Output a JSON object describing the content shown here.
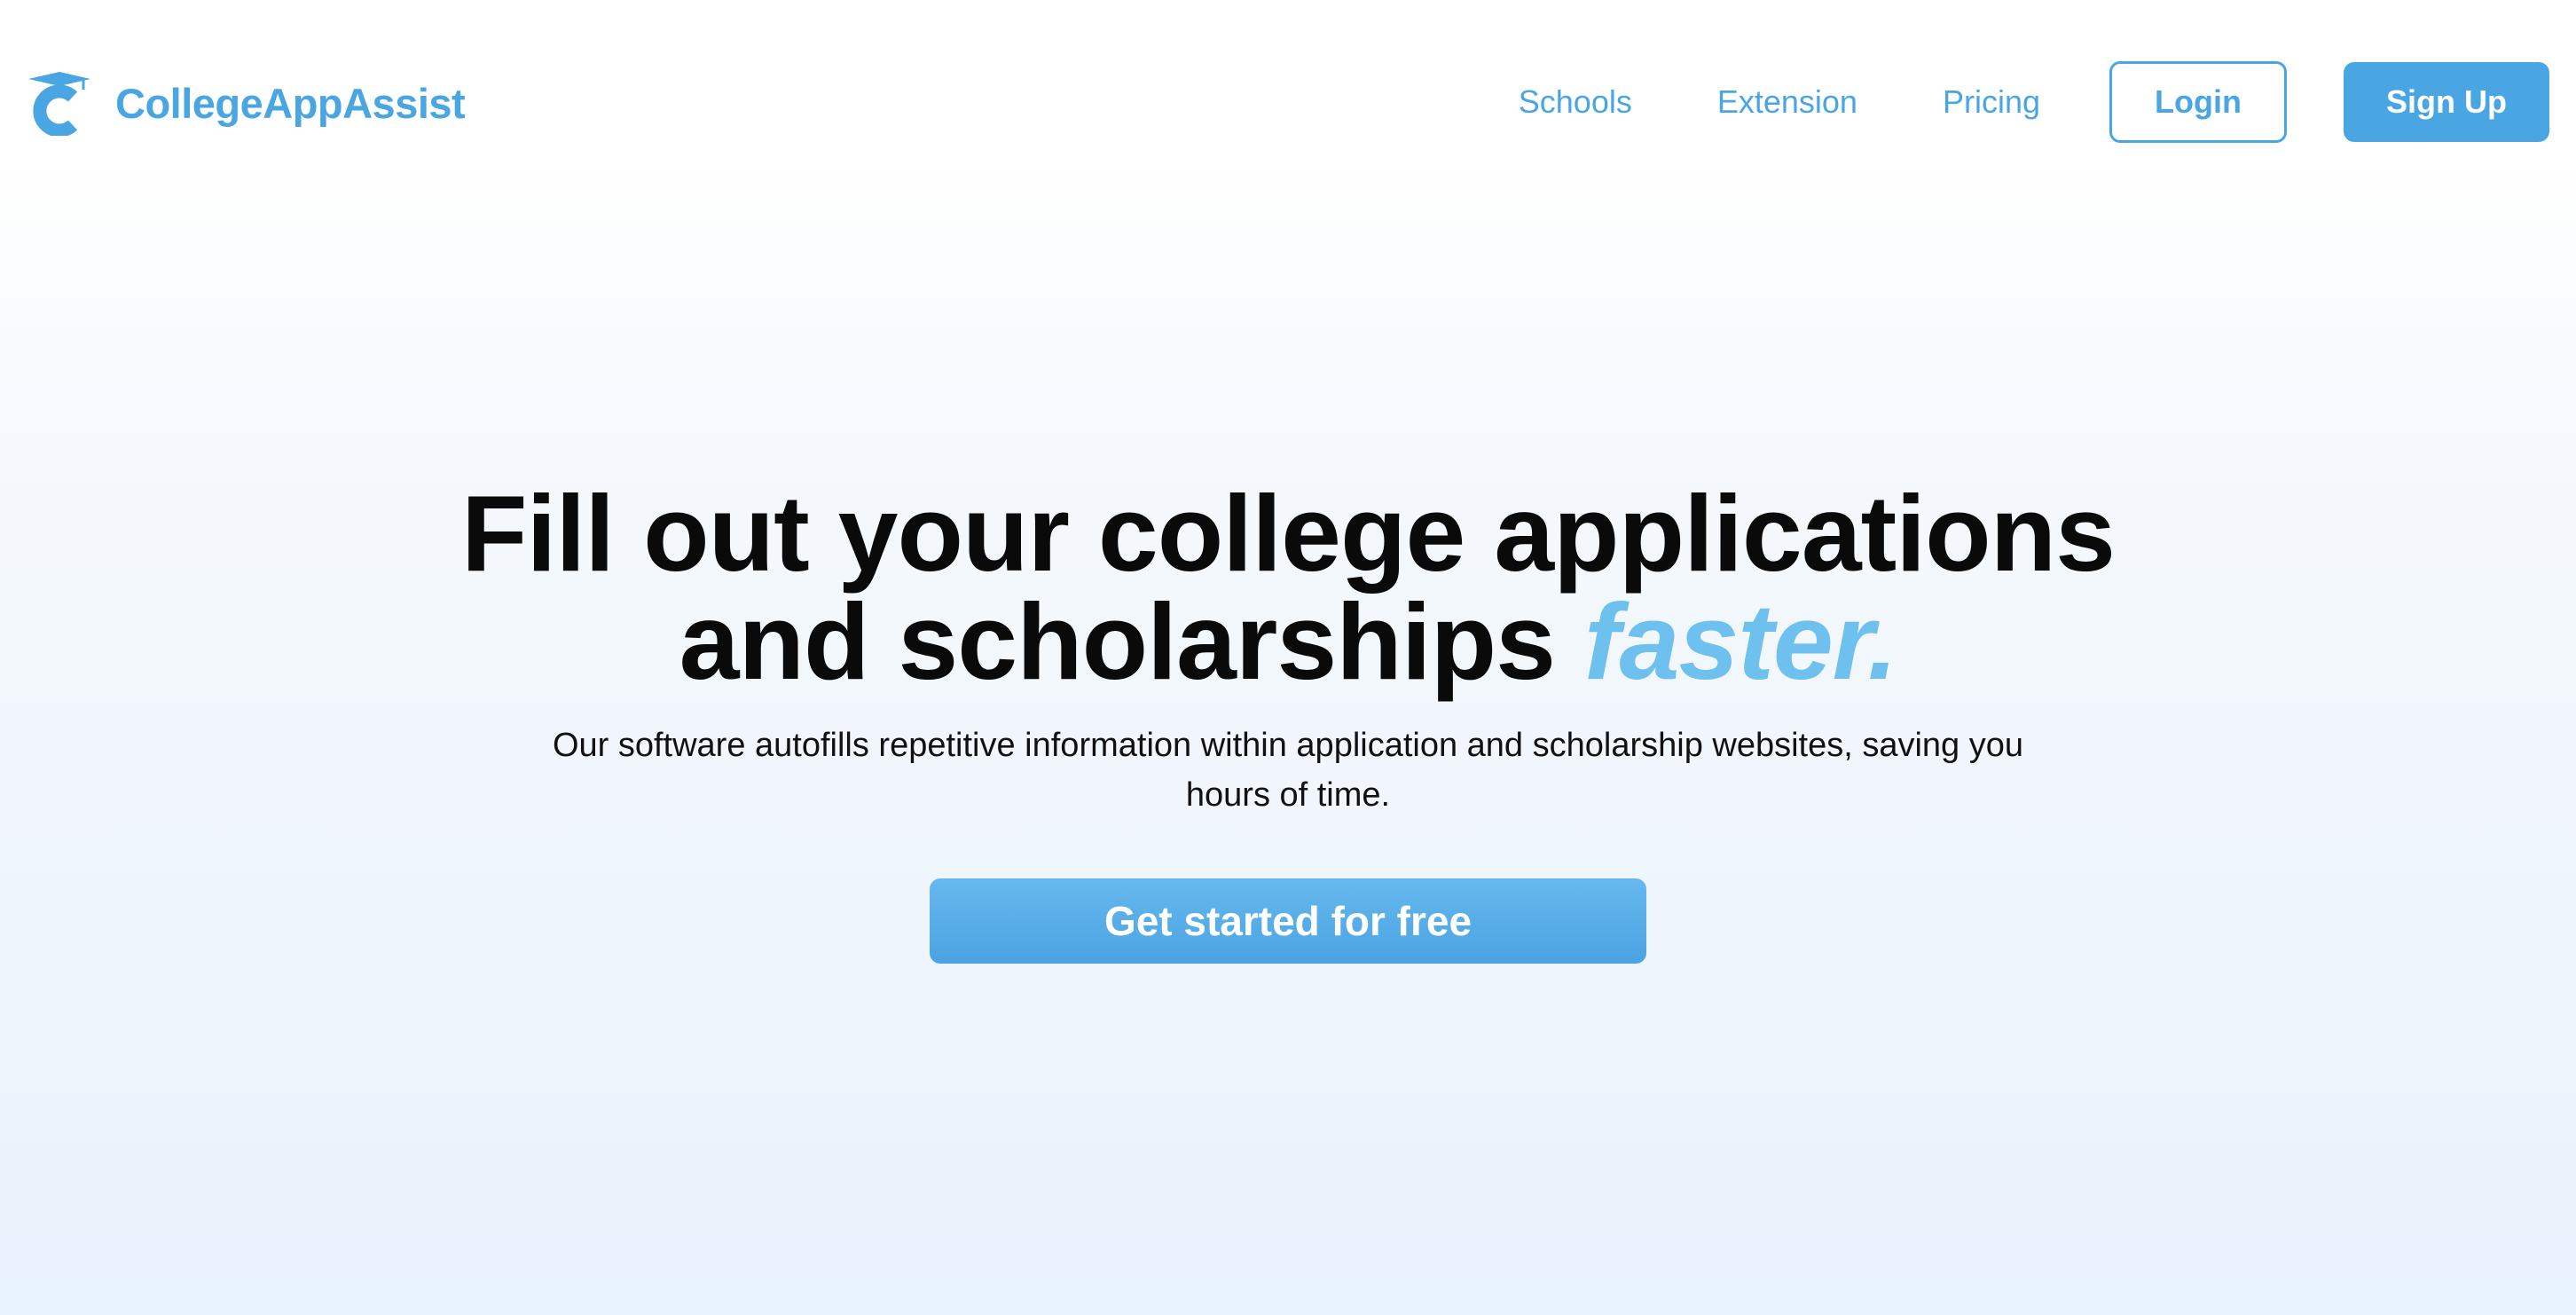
{
  "brand": {
    "name": "CollegeAppAssist",
    "logo_icon": "graduation-cap-c-logo",
    "color": "#4aa6e3"
  },
  "nav": {
    "links": [
      {
        "label": "Schools"
      },
      {
        "label": "Extension"
      },
      {
        "label": "Pricing"
      }
    ],
    "login_label": "Login",
    "signup_label": "Sign Up"
  },
  "hero": {
    "title_line1": "Fill out your college applications",
    "title_line2": "and scholarships",
    "title_accent": "faster.",
    "subtitle": "Our software autofills repetitive information within application and scholarship websites, saving you hours of time.",
    "cta_label": "Get started for free"
  },
  "colors": {
    "accent": "#4aa6e3",
    "accent_light": "#6ec1ee",
    "text": "#0a0a0a",
    "background_bottom": "#e8f2fc"
  }
}
